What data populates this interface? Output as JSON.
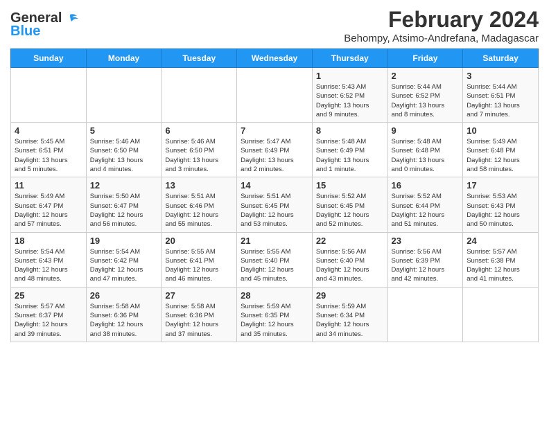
{
  "header": {
    "logo_general": "General",
    "logo_blue": "Blue",
    "title": "February 2024",
    "subtitle": "Behompy, Atsimo-Andrefana, Madagascar"
  },
  "calendar": {
    "days_of_week": [
      "Sunday",
      "Monday",
      "Tuesday",
      "Wednesday",
      "Thursday",
      "Friday",
      "Saturday"
    ],
    "weeks": [
      {
        "row_class": "row-odd",
        "days": [
          {
            "num": "",
            "info": ""
          },
          {
            "num": "",
            "info": ""
          },
          {
            "num": "",
            "info": ""
          },
          {
            "num": "",
            "info": ""
          },
          {
            "num": "1",
            "info": "Sunrise: 5:43 AM\nSunset: 6:52 PM\nDaylight: 13 hours\nand 9 minutes."
          },
          {
            "num": "2",
            "info": "Sunrise: 5:44 AM\nSunset: 6:52 PM\nDaylight: 13 hours\nand 8 minutes."
          },
          {
            "num": "3",
            "info": "Sunrise: 5:44 AM\nSunset: 6:51 PM\nDaylight: 13 hours\nand 7 minutes."
          }
        ]
      },
      {
        "row_class": "row-even",
        "days": [
          {
            "num": "4",
            "info": "Sunrise: 5:45 AM\nSunset: 6:51 PM\nDaylight: 13 hours\nand 5 minutes."
          },
          {
            "num": "5",
            "info": "Sunrise: 5:46 AM\nSunset: 6:50 PM\nDaylight: 13 hours\nand 4 minutes."
          },
          {
            "num": "6",
            "info": "Sunrise: 5:46 AM\nSunset: 6:50 PM\nDaylight: 13 hours\nand 3 minutes."
          },
          {
            "num": "7",
            "info": "Sunrise: 5:47 AM\nSunset: 6:49 PM\nDaylight: 13 hours\nand 2 minutes."
          },
          {
            "num": "8",
            "info": "Sunrise: 5:48 AM\nSunset: 6:49 PM\nDaylight: 13 hours\nand 1 minute."
          },
          {
            "num": "9",
            "info": "Sunrise: 5:48 AM\nSunset: 6:48 PM\nDaylight: 13 hours\nand 0 minutes."
          },
          {
            "num": "10",
            "info": "Sunrise: 5:49 AM\nSunset: 6:48 PM\nDaylight: 12 hours\nand 58 minutes."
          }
        ]
      },
      {
        "row_class": "row-odd",
        "days": [
          {
            "num": "11",
            "info": "Sunrise: 5:49 AM\nSunset: 6:47 PM\nDaylight: 12 hours\nand 57 minutes."
          },
          {
            "num": "12",
            "info": "Sunrise: 5:50 AM\nSunset: 6:47 PM\nDaylight: 12 hours\nand 56 minutes."
          },
          {
            "num": "13",
            "info": "Sunrise: 5:51 AM\nSunset: 6:46 PM\nDaylight: 12 hours\nand 55 minutes."
          },
          {
            "num": "14",
            "info": "Sunrise: 5:51 AM\nSunset: 6:45 PM\nDaylight: 12 hours\nand 53 minutes."
          },
          {
            "num": "15",
            "info": "Sunrise: 5:52 AM\nSunset: 6:45 PM\nDaylight: 12 hours\nand 52 minutes."
          },
          {
            "num": "16",
            "info": "Sunrise: 5:52 AM\nSunset: 6:44 PM\nDaylight: 12 hours\nand 51 minutes."
          },
          {
            "num": "17",
            "info": "Sunrise: 5:53 AM\nSunset: 6:43 PM\nDaylight: 12 hours\nand 50 minutes."
          }
        ]
      },
      {
        "row_class": "row-even",
        "days": [
          {
            "num": "18",
            "info": "Sunrise: 5:54 AM\nSunset: 6:43 PM\nDaylight: 12 hours\nand 48 minutes."
          },
          {
            "num": "19",
            "info": "Sunrise: 5:54 AM\nSunset: 6:42 PM\nDaylight: 12 hours\nand 47 minutes."
          },
          {
            "num": "20",
            "info": "Sunrise: 5:55 AM\nSunset: 6:41 PM\nDaylight: 12 hours\nand 46 minutes."
          },
          {
            "num": "21",
            "info": "Sunrise: 5:55 AM\nSunset: 6:40 PM\nDaylight: 12 hours\nand 45 minutes."
          },
          {
            "num": "22",
            "info": "Sunrise: 5:56 AM\nSunset: 6:40 PM\nDaylight: 12 hours\nand 43 minutes."
          },
          {
            "num": "23",
            "info": "Sunrise: 5:56 AM\nSunset: 6:39 PM\nDaylight: 12 hours\nand 42 minutes."
          },
          {
            "num": "24",
            "info": "Sunrise: 5:57 AM\nSunset: 6:38 PM\nDaylight: 12 hours\nand 41 minutes."
          }
        ]
      },
      {
        "row_class": "row-odd",
        "days": [
          {
            "num": "25",
            "info": "Sunrise: 5:57 AM\nSunset: 6:37 PM\nDaylight: 12 hours\nand 39 minutes."
          },
          {
            "num": "26",
            "info": "Sunrise: 5:58 AM\nSunset: 6:36 PM\nDaylight: 12 hours\nand 38 minutes."
          },
          {
            "num": "27",
            "info": "Sunrise: 5:58 AM\nSunset: 6:36 PM\nDaylight: 12 hours\nand 37 minutes."
          },
          {
            "num": "28",
            "info": "Sunrise: 5:59 AM\nSunset: 6:35 PM\nDaylight: 12 hours\nand 35 minutes."
          },
          {
            "num": "29",
            "info": "Sunrise: 5:59 AM\nSunset: 6:34 PM\nDaylight: 12 hours\nand 34 minutes."
          },
          {
            "num": "",
            "info": ""
          },
          {
            "num": "",
            "info": ""
          }
        ]
      }
    ]
  }
}
